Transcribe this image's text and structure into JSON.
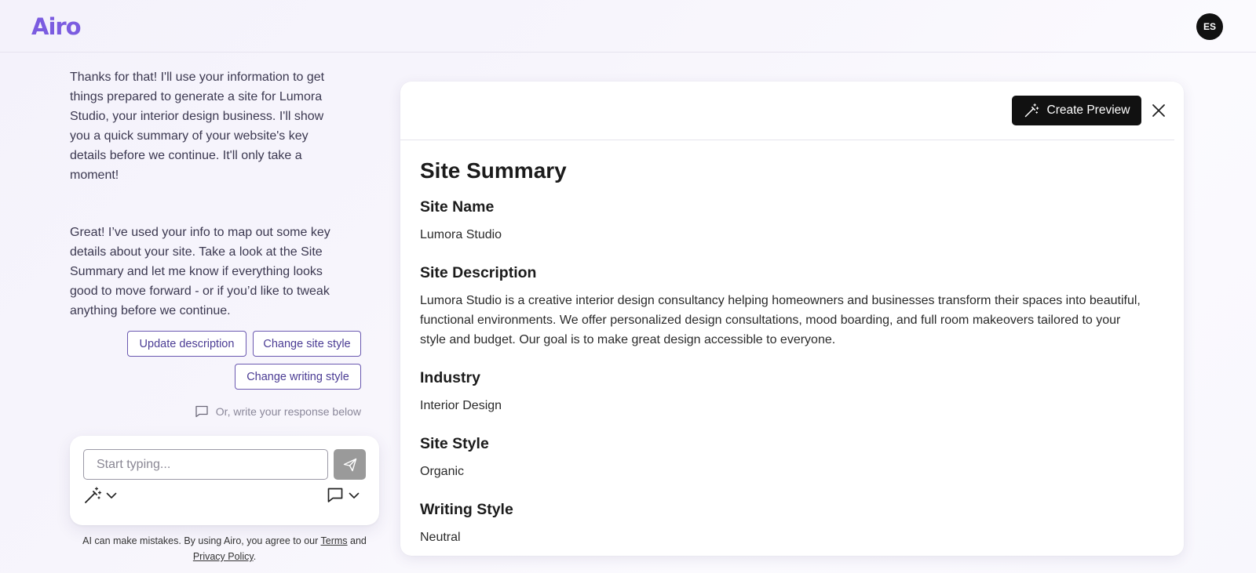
{
  "app": {
    "logo": "Airo",
    "avatar_initials": "ES"
  },
  "chat": {
    "messages": [
      "Thanks for that! I'll use your information to get things prepared to generate a site for Lumora Studio, your interior design business. I'll show you a quick summary of your website's key details before we continue. It'll only take a moment!",
      "Great! I’ve used your info to map out some key details about your site. Take a look at the Site Summary and let me know if everything looks good to move forward - or if you’d like to tweak anything before we continue."
    ],
    "actions": {
      "update_description": "Update description",
      "change_site_style": "Change site style",
      "change_writing_style": "Change writing style"
    },
    "hint": "Or, write your response below",
    "input_placeholder": "Start typing...",
    "disclaimer": {
      "prefix": "AI can make mistakes. By using Airo, you agree to our",
      "terms": "Terms",
      "and": "and",
      "privacy": "Privacy Policy",
      "suffix": "."
    }
  },
  "panel": {
    "create_preview_label": "Create Preview",
    "title": "Site Summary",
    "fields": {
      "site_name": {
        "label": "Site Name",
        "value": "Lumora Studio"
      },
      "site_description": {
        "label": "Site Description",
        "value": "Lumora Studio is a creative interior design consultancy helping homeowners and businesses transform their spaces into beautiful, functional environments. We offer personalized design consultations, mood boarding, and full room makeovers tailored to your style and budget. Our goal is to make great design accessible to everyone."
      },
      "industry": {
        "label": "Industry",
        "value": "Interior Design"
      },
      "site_style": {
        "label": "Site Style",
        "value": "Organic"
      },
      "writing_style": {
        "label": "Writing Style",
        "value": "Neutral"
      }
    }
  },
  "colors": {
    "brand": "#7b5ce0",
    "chip_border": "#6a58b0",
    "dark_button": "#111111",
    "send_button": "#9a9a9a"
  },
  "icons": {
    "wand": "magic-wand-icon",
    "chat": "chat-bubble-icon",
    "send": "send-icon",
    "close": "close-icon",
    "chevron": "chevron-down-icon"
  }
}
